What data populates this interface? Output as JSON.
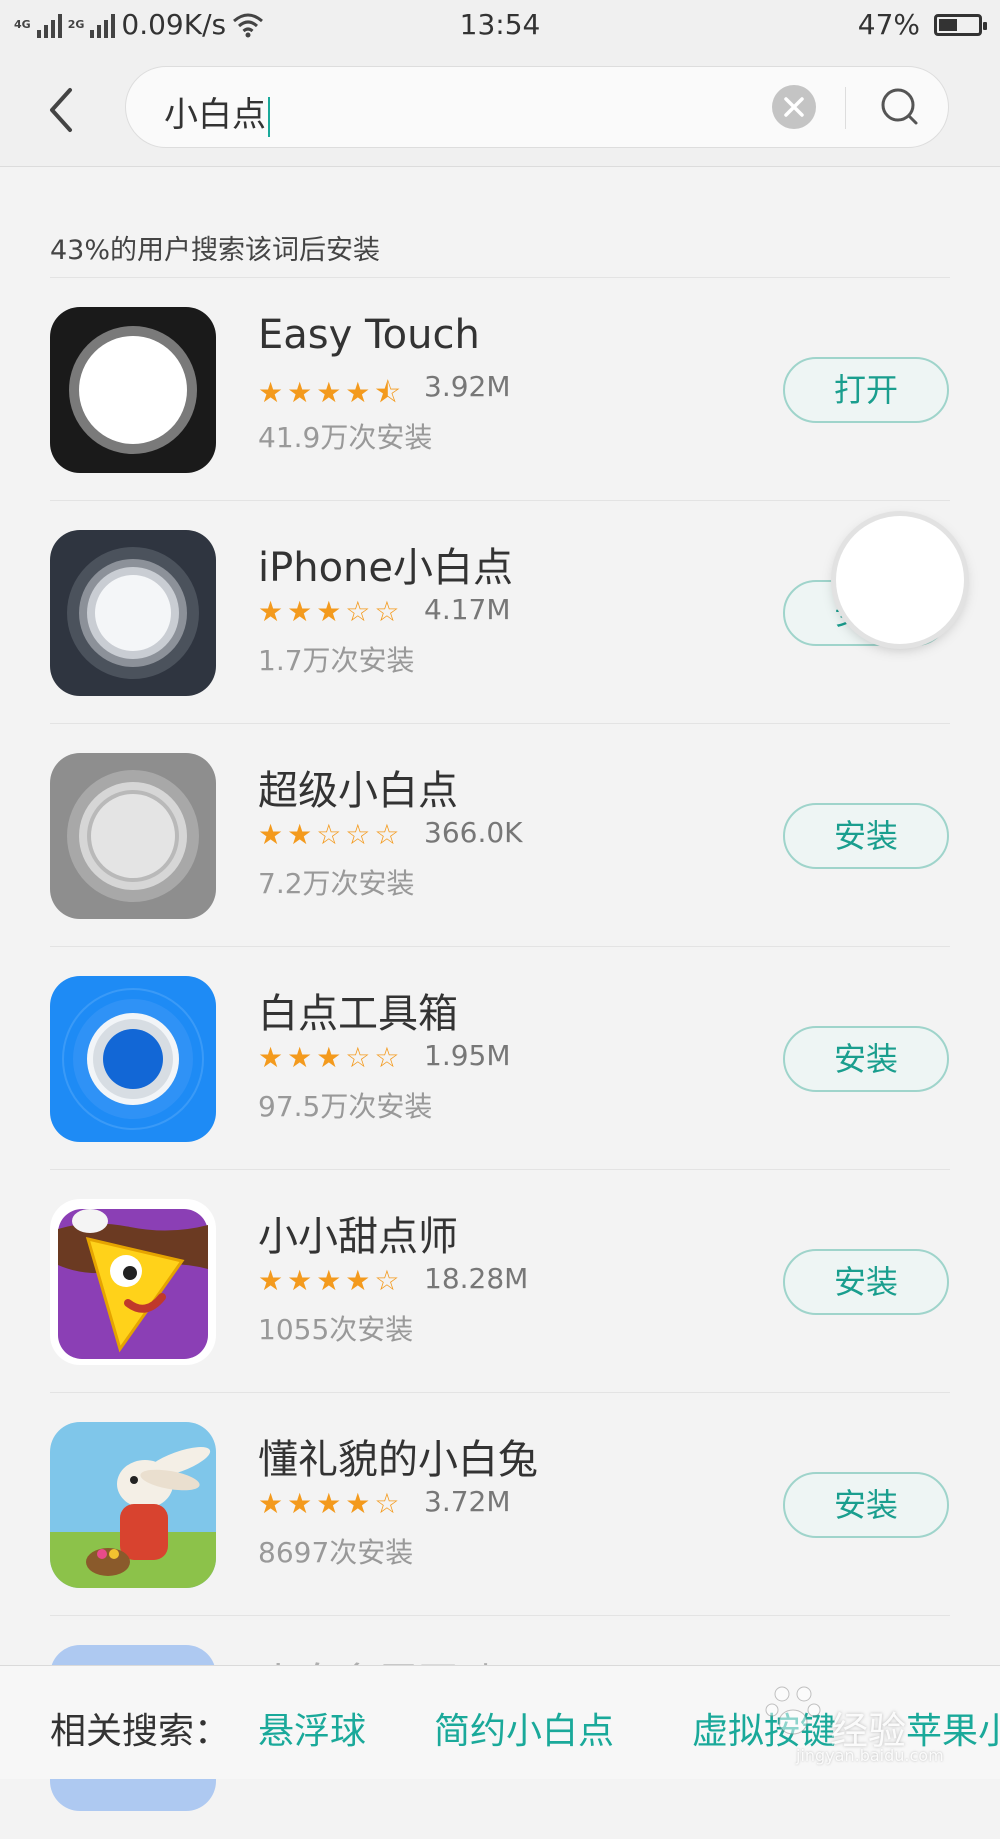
{
  "status_bar": {
    "net1": "4G",
    "net2": "2G",
    "speed": "0.09K/s",
    "time": "13:54",
    "battery": "47%",
    "battery_level": 0.47
  },
  "search": {
    "query": "小白点"
  },
  "hint": "43%的用户搜索该词后安装",
  "apps": [
    {
      "name": "Easy Touch",
      "stars": "★★★★⯪",
      "size": "3.92M",
      "installs": "41.9万次安装",
      "button": "打开"
    },
    {
      "name": "iPhone小白点",
      "stars": "★★★☆☆",
      "size": "4.17M",
      "installs": "1.7万次安装",
      "button": "安装"
    },
    {
      "name": "超级小白点",
      "stars": "★★☆☆☆",
      "size": "366.0K",
      "installs": "7.2万次安装",
      "button": "安装"
    },
    {
      "name": "白点工具箱",
      "stars": "★★★☆☆",
      "size": "1.95M",
      "installs": "97.5万次安装",
      "button": "安装"
    },
    {
      "name": "小小甜点师",
      "stars": "★★★★☆",
      "size": "18.28M",
      "installs": "1055次安装",
      "button": "安装"
    },
    {
      "name": "懂礼貌的小白兔",
      "stars": "★★★★☆",
      "size": "3.72M",
      "installs": "8697次安装",
      "button": "安装"
    },
    {
      "name": "小白多屏互动",
      "stars": "",
      "size": "",
      "installs": "",
      "button": ""
    }
  ],
  "related": {
    "label": "相关搜索：",
    "keywords": [
      "悬浮球",
      "简约小白点",
      "虚拟按键",
      "苹果小白点"
    ]
  },
  "watermark": {
    "text": "经验",
    "sub": "jingyan.baidu.com"
  },
  "colors": {
    "accent": "#1aa99a",
    "star": "#f39a1d"
  }
}
